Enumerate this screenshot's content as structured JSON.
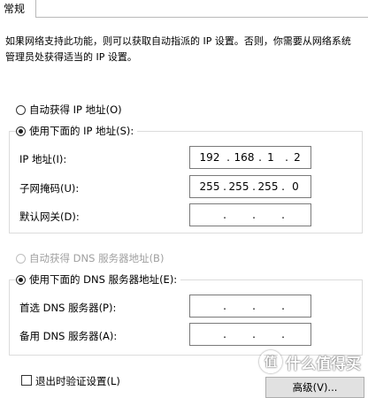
{
  "tab": {
    "label": "常规"
  },
  "description": "如果网络支持此功能，则可以获取自动指派的 IP 设置。否则，你需要从网络系统管理员处获得适当的 IP 设置。",
  "ip_section": {
    "auto_label": "自动获得 IP 地址(O)",
    "manual_label": "使用下面的 IP 地址(S):",
    "selected": "manual",
    "fields": [
      {
        "label": "IP 地址(I):",
        "octets": [
          "192",
          "168",
          "1",
          "2"
        ]
      },
      {
        "label": "子网掩码(U):",
        "octets": [
          "255",
          "255",
          "255",
          "0"
        ]
      },
      {
        "label": "默认网关(D):",
        "octets": [
          "",
          "",
          "",
          ""
        ]
      }
    ]
  },
  "dns_section": {
    "auto_label": "自动获得 DNS 服务器地址(B)",
    "manual_label": "使用下面的 DNS 服务器地址(E):",
    "selected": "manual",
    "auto_disabled": true,
    "fields": [
      {
        "label": "首选 DNS 服务器(P):",
        "octets": [
          "",
          "",
          "",
          ""
        ]
      },
      {
        "label": "备用 DNS 服务器(A):",
        "octets": [
          "",
          "",
          "",
          ""
        ]
      }
    ]
  },
  "validate_label": "退出时验证设置(L)",
  "advanced_button": "高级(V)...",
  "watermark": {
    "badge": "值",
    "text": "什么值得买"
  },
  "colors": {
    "disabled_text": "#a0a0a0",
    "border": "#7a7a7a",
    "group_border": "#dcdcdc"
  }
}
